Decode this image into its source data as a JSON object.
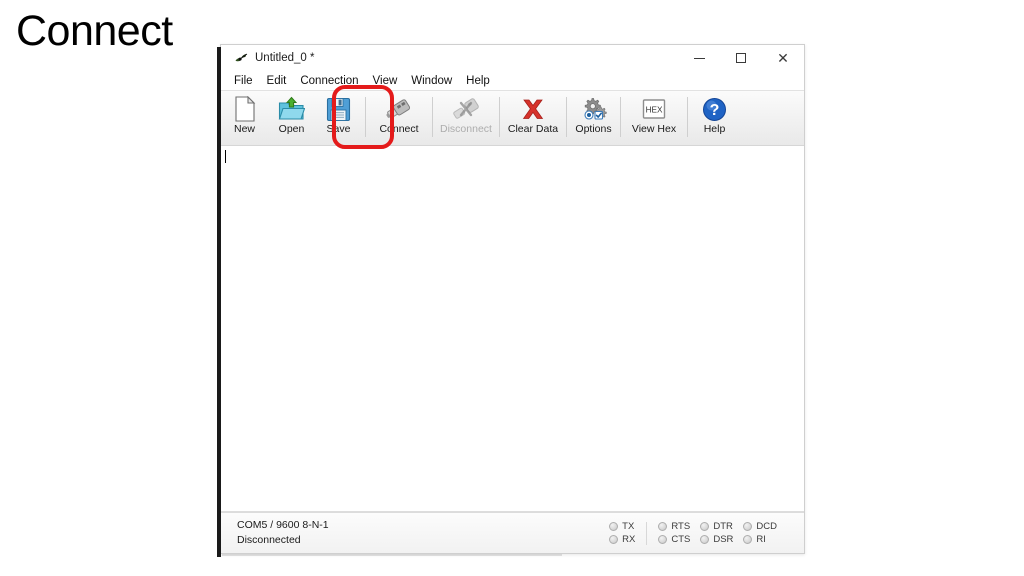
{
  "slide": {
    "title": "Connect"
  },
  "window": {
    "title": "Untitled_0 *",
    "app_icon": "moth-icon",
    "controls": {
      "minimize": "minimize-icon",
      "maximize": "maximize-icon",
      "close": "close-icon"
    }
  },
  "menubar": {
    "items": [
      {
        "label": "File"
      },
      {
        "label": "Edit"
      },
      {
        "label": "Connection"
      },
      {
        "label": "View"
      },
      {
        "label": "Window"
      },
      {
        "label": "Help"
      }
    ]
  },
  "toolbar": {
    "buttons": [
      {
        "label": "New",
        "icon": "new-document-icon",
        "enabled": true
      },
      {
        "label": "Open",
        "icon": "open-folder-icon",
        "enabled": true
      },
      {
        "label": "Save",
        "icon": "floppy-disk-icon",
        "enabled": true
      },
      {
        "label": "Connect",
        "icon": "usb-plug-icon",
        "enabled": true
      },
      {
        "label": "Disconnect",
        "icon": "broken-plug-icon",
        "enabled": false
      },
      {
        "label": "Clear Data",
        "icon": "red-x-icon",
        "enabled": true
      },
      {
        "label": "Options",
        "icon": "gears-icon",
        "enabled": true
      },
      {
        "label": "View Hex",
        "icon": "hex-icon",
        "enabled": true
      },
      {
        "label": "Help",
        "icon": "question-mark-icon",
        "enabled": true
      }
    ],
    "highlight": {
      "target": "Connect",
      "color": "#e41b1b"
    }
  },
  "statusbar": {
    "port_info": "COM5 / 9600 8-N-1",
    "connection_state": "Disconnected",
    "led_groups": [
      {
        "leds": [
          {
            "label": "TX",
            "on": false
          },
          {
            "label": "RX",
            "on": false
          }
        ]
      },
      {
        "leds": [
          {
            "label": "RTS",
            "on": false
          },
          {
            "label": "CTS",
            "on": false
          }
        ]
      },
      {
        "leds": [
          {
            "label": "DTR",
            "on": false
          },
          {
            "label": "DSR",
            "on": false
          }
        ]
      },
      {
        "leds": [
          {
            "label": "DCD",
            "on": false
          },
          {
            "label": "RI",
            "on": false
          }
        ]
      }
    ]
  }
}
